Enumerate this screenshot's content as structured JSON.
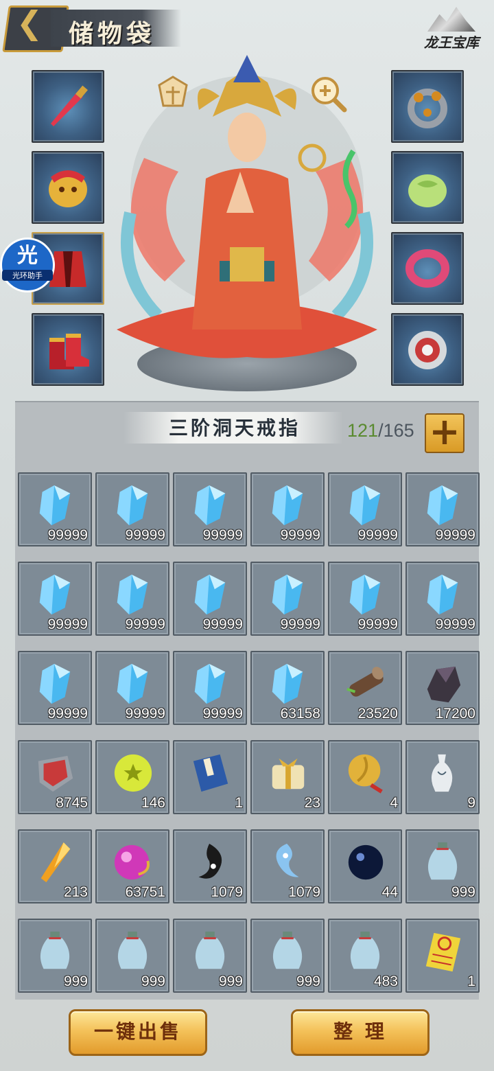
{
  "header": {
    "title": "储物袋",
    "treasure_label": "龙王宝库",
    "back_icon": "chevron-left-icon"
  },
  "halo_helper": {
    "char": "光",
    "label": "光环助手"
  },
  "equipment_left": [
    "weapon-sword",
    "helmet",
    "armor-robe",
    "boots"
  ],
  "equipment_right": [
    "ring",
    "jade-pendant",
    "bracelet",
    "amulet"
  ],
  "bag": {
    "ring_name": "三阶洞天戒指",
    "used": "121",
    "total": "/165"
  },
  "items": [
    {
      "icon": "crystal",
      "qty": "99999"
    },
    {
      "icon": "crystal",
      "qty": "99999"
    },
    {
      "icon": "crystal",
      "qty": "99999"
    },
    {
      "icon": "crystal",
      "qty": "99999"
    },
    {
      "icon": "crystal",
      "qty": "99999"
    },
    {
      "icon": "crystal",
      "qty": "99999"
    },
    {
      "icon": "crystal",
      "qty": "99999"
    },
    {
      "icon": "crystal",
      "qty": "99999"
    },
    {
      "icon": "crystal",
      "qty": "99999"
    },
    {
      "icon": "crystal",
      "qty": "99999"
    },
    {
      "icon": "crystal",
      "qty": "99999"
    },
    {
      "icon": "crystal",
      "qty": "99999"
    },
    {
      "icon": "crystal",
      "qty": "99999"
    },
    {
      "icon": "crystal",
      "qty": "99999"
    },
    {
      "icon": "crystal",
      "qty": "99999"
    },
    {
      "icon": "crystal",
      "qty": "63158"
    },
    {
      "icon": "wood-log",
      "qty": "23520"
    },
    {
      "icon": "ore",
      "qty": "17200"
    },
    {
      "icon": "red-charm",
      "qty": "8745"
    },
    {
      "icon": "star-orb",
      "qty": "146"
    },
    {
      "icon": "book",
      "qty": "1"
    },
    {
      "icon": "gift-box",
      "qty": "23"
    },
    {
      "icon": "gold-pendant",
      "qty": "4"
    },
    {
      "icon": "vase",
      "qty": "9"
    },
    {
      "icon": "amber-shard",
      "qty": "213"
    },
    {
      "icon": "pink-orb",
      "qty": "63751"
    },
    {
      "icon": "black-yin",
      "qty": "1079"
    },
    {
      "icon": "blue-yang",
      "qty": "1079"
    },
    {
      "icon": "dark-pearl",
      "qty": "44"
    },
    {
      "icon": "potion-bottle",
      "qty": "999"
    },
    {
      "icon": "potion-bottle",
      "qty": "999"
    },
    {
      "icon": "potion-bottle",
      "qty": "999"
    },
    {
      "icon": "potion-bottle",
      "qty": "999"
    },
    {
      "icon": "potion-bottle",
      "qty": "999"
    },
    {
      "icon": "potion-bottle",
      "qty": "483"
    },
    {
      "icon": "scroll-talisman",
      "qty": "1"
    }
  ],
  "actions": {
    "sell_all": "一键出售",
    "organize": "整 理"
  },
  "colors": {
    "crystal": "#49b8f0",
    "gold": "#e6a930",
    "panel": "#b7bcbf"
  }
}
